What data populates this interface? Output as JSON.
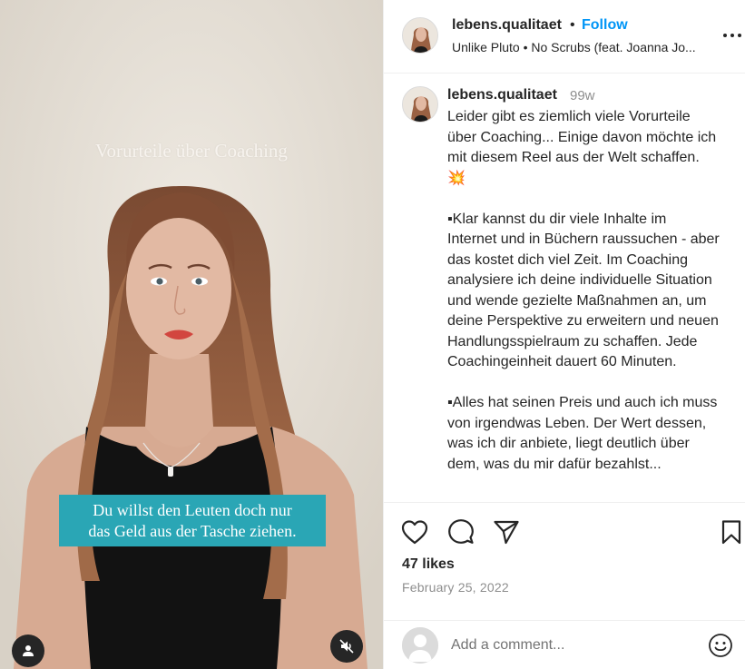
{
  "video": {
    "overlay_title": "Vorurteile über Coaching",
    "caption_line1": "Du willst den Leuten doch nur",
    "caption_line2": "das Geld aus der Tasche ziehen."
  },
  "header": {
    "username": "lebens.qualitaet",
    "separator": "•",
    "follow_label": "Follow",
    "audio": "Unlike Pluto • No Scrubs (feat. Joanna Jo..."
  },
  "post": {
    "username": "lebens.qualitaet",
    "time": "99w",
    "caption": "Leider gibt es ziemlich viele Vorurteile über Coaching... Einige davon möchte ich mit diesem Reel aus der Welt schaffen. 💥\n\n▪︎Klar kannst du dir viele Inhalte im Internet und in Büchern raussuchen - aber das kostet dich viel Zeit. Im Coaching analysiere ich deine individuelle Situation und wende gezielte Maßnahmen an, um deine Perspektive zu erweitern und neuen Handlungsspielraum zu schaffen. Jede Coachingeinheit dauert 60 Minuten.\n\n▪︎Alles hat seinen Preis und auch ich muss von irgendwas Leben. Der Wert dessen, was ich dir anbiete, liegt deutlich über dem, was du mir dafür bezahlst..."
  },
  "engagement": {
    "likes": "47 likes",
    "date": "February 25, 2022"
  },
  "add_comment": {
    "placeholder": "Add a comment..."
  },
  "colors": {
    "follow_blue": "#0095f6",
    "caption_teal": "#2aa6b5",
    "muted_text": "#8e8e8e"
  }
}
